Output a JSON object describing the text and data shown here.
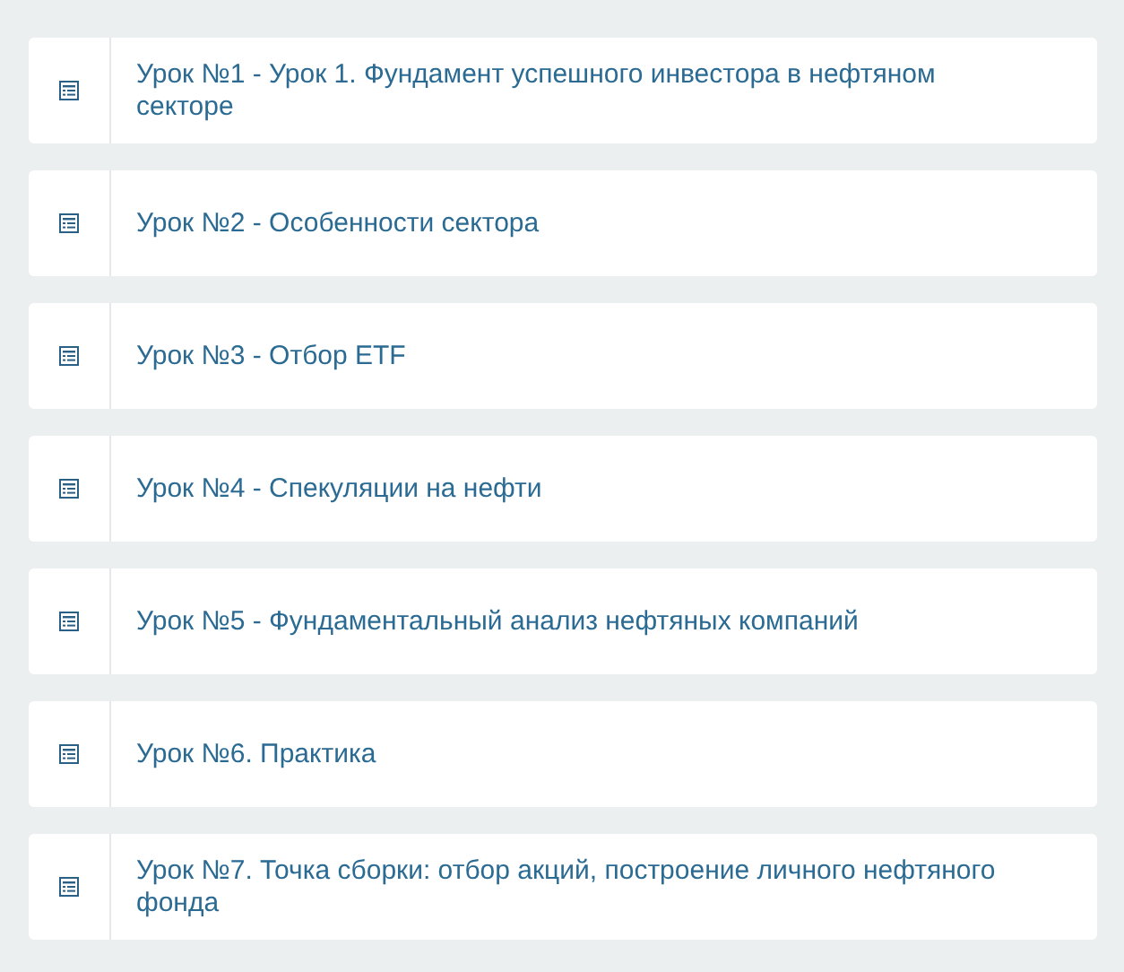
{
  "lessons": [
    {
      "title": "Урок №1 - Урок 1. Фундамент успешного инвестора в нефтяном секторе"
    },
    {
      "title": "Урок №2 - Особенности сектора"
    },
    {
      "title": "Урок №3 - Отбор ETF"
    },
    {
      "title": "Урок №4 - Спекуляции на нефти"
    },
    {
      "title": "Урок №5 - Фундаментальный анализ нефтяных компаний"
    },
    {
      "title": "Урок №6. Практика"
    },
    {
      "title": "Урок №7. Точка сборки: отбор акций, построение личного нефтяного фонда"
    }
  ]
}
